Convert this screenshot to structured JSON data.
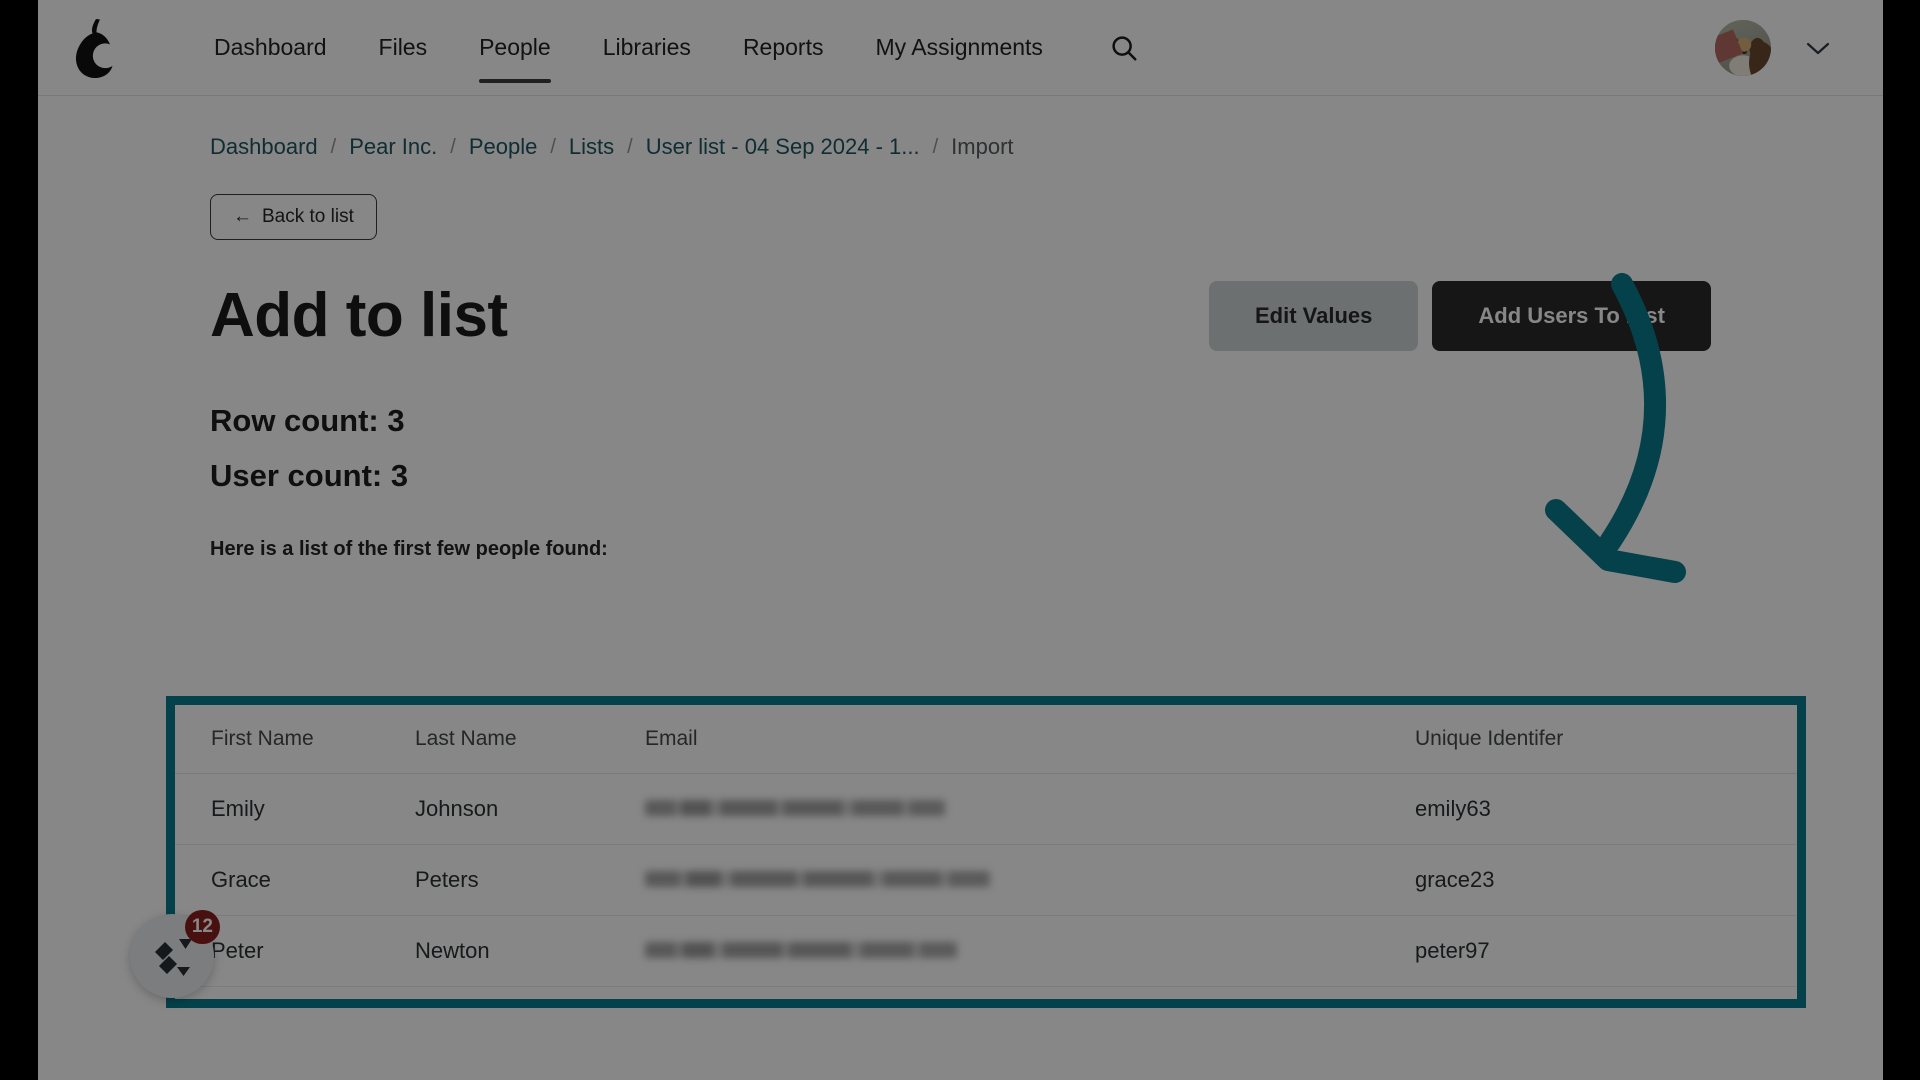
{
  "nav": {
    "logo_icon": "pear-logo-icon",
    "links": [
      {
        "label": "Dashboard",
        "active": false
      },
      {
        "label": "Files",
        "active": false
      },
      {
        "label": "People",
        "active": true
      },
      {
        "label": "Libraries",
        "active": false
      },
      {
        "label": "Reports",
        "active": false
      },
      {
        "label": "My Assignments",
        "active": false
      }
    ],
    "search_icon": "search-icon",
    "avatar_icon": "user-avatar-dog-photo",
    "chevron_icon": "chevron-down-icon"
  },
  "breadcrumb": {
    "items": [
      {
        "label": "Dashboard",
        "current": false
      },
      {
        "label": "Pear Inc.",
        "current": false
      },
      {
        "label": "People",
        "current": false
      },
      {
        "label": "Lists",
        "current": false
      },
      {
        "label": "User list - 04 Sep 2024 - 1...",
        "current": false
      },
      {
        "label": "Import",
        "current": true
      }
    ],
    "separator": "/"
  },
  "back_button": {
    "arrow": "←",
    "label": "Back to list"
  },
  "header": {
    "title": "Add to list",
    "edit_values_label": "Edit Values",
    "add_users_label": "Add Users To List"
  },
  "counts": {
    "row_count": "Row count: 3",
    "user_count": "User count: 3"
  },
  "found_label": "Here is a list of the first few people found:",
  "table": {
    "columns": [
      "First Name",
      "Last Name",
      "Email",
      "Unique Identifer"
    ],
    "rows": [
      {
        "first": "Emily",
        "last": "Johnson",
        "email": "",
        "uid": "emily63"
      },
      {
        "first": "Grace",
        "last": "Peters",
        "email": "",
        "uid": "grace23"
      },
      {
        "first": "Peter",
        "last": "Newton",
        "email": "",
        "uid": "peter97"
      }
    ]
  },
  "help_widget": {
    "icon": "chat-help-icon",
    "badge": "12"
  },
  "annotation": {
    "arrow_icon": "curved-down-arrow-annotation",
    "color": "#0b7b8c"
  },
  "colors": {
    "accent_teal": "#0b7b8c",
    "link": "#1f5662",
    "primary_button": "#2a2a2a",
    "secondary_button": "#cfd3d4",
    "badge_red": "#8a1f1f"
  }
}
